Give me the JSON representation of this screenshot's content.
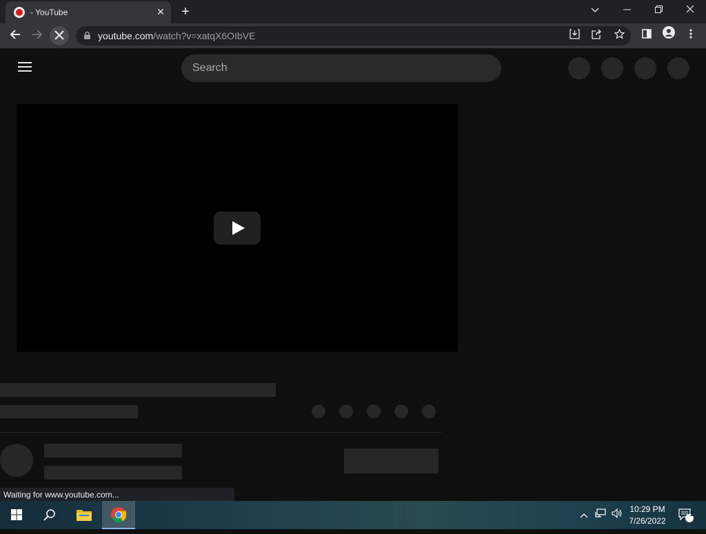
{
  "browser": {
    "tab_title": "- YouTube",
    "tab_close": "✕",
    "new_tab": "+",
    "url_host": "youtube.com",
    "url_path": "/watch?v=xatqX6OIbVE",
    "status_text": "Waiting for www.youtube.com..."
  },
  "page": {
    "search_placeholder": "Search"
  },
  "taskbar": {
    "time": "10:29 PM",
    "date": "7/26/2022",
    "notification_count": "1"
  }
}
